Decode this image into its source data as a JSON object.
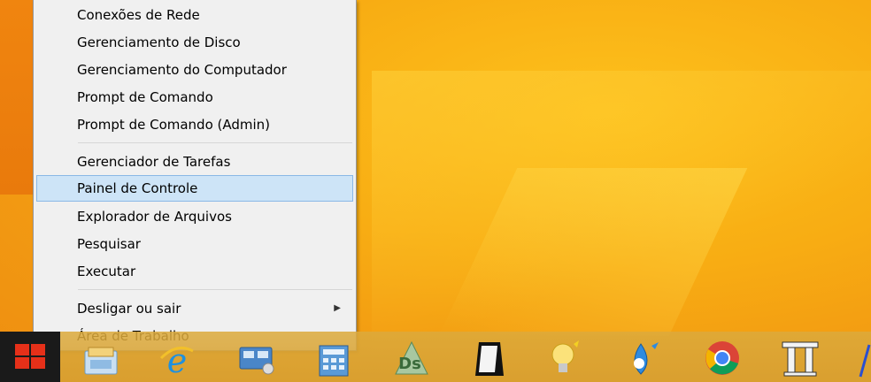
{
  "menu": {
    "items_group1": [
      "Conexões de Rede",
      "Gerenciamento de Disco",
      "Gerenciamento do Computador",
      "Prompt de Comando",
      "Prompt de Comando (Admin)"
    ],
    "items_group2": [
      "Gerenciador de Tarefas",
      "Painel de Controle",
      "Explorador de Arquivos",
      "Pesquisar",
      "Executar"
    ],
    "items_group3": [
      "Desligar ou sair",
      "Área de Trabalho"
    ],
    "selected_item": "Painel de Controle"
  },
  "taskbar": {
    "icons": [
      "file-manager-icon",
      "internet-explorer-icon",
      "network-icon",
      "calculator-icon",
      "ds-app-icon",
      "document-app-icon",
      "bulb-app-icon",
      "drop-app-icon",
      "chrome-icon",
      "pillar-app-icon"
    ]
  },
  "colors": {
    "accent": "#f8ad13",
    "selection": "#cde4f7",
    "start": "#e63019"
  }
}
